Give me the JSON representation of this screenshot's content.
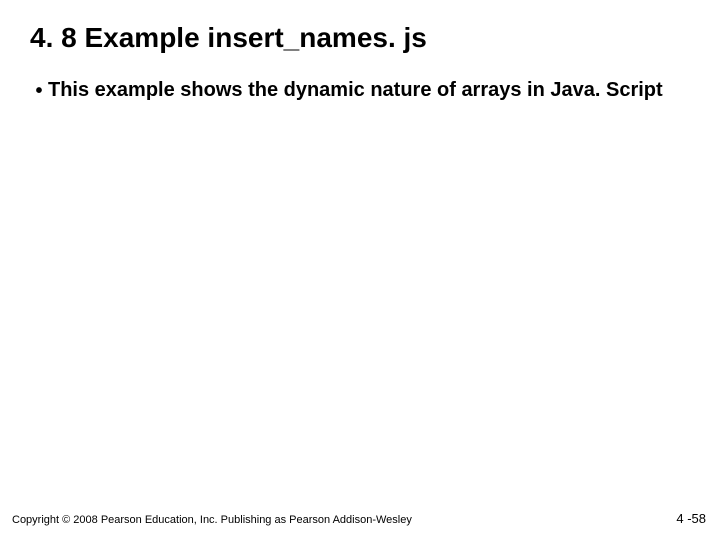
{
  "title": "4. 8 Example insert_names. js",
  "bullets": [
    "This example shows the dynamic nature of arrays in Java. Script"
  ],
  "footer": {
    "copyright": "Copyright © 2008 Pearson Education, Inc. Publishing as Pearson Addison-Wesley",
    "page": "4 -58"
  }
}
